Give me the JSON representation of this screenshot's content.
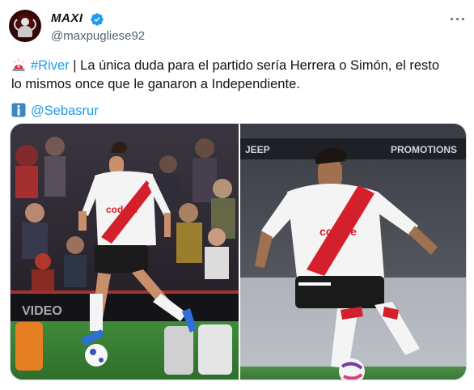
{
  "author": {
    "display_name": "MAXI",
    "handle": "@maxpugliese92",
    "avatar_icon": "profile-avatar",
    "verified_icon": "verified-badge-icon",
    "verified_color": "#1d9bf0"
  },
  "menu": {
    "more_icon": "···"
  },
  "tweet": {
    "hashtag": "#River",
    "separator": " | ",
    "line1_rest": "La única duda para el partido sería Herrera o Simón, el resto",
    "line2": "lo mismos once que le ganaron a Independiente.",
    "mention": "@Sebasrur",
    "emoji1": "rotating-light-emoji",
    "emoji2": "info-emoji"
  },
  "media": {
    "left_sponsor": "codere",
    "right_sponsor": "codere",
    "right_banner": "PROMOTIONS",
    "left_banner": "VIDEO"
  },
  "colors": {
    "link": "#1d9bf0",
    "text": "#0f1419",
    "secondary": "#536471",
    "river_red": "#d4202c"
  }
}
